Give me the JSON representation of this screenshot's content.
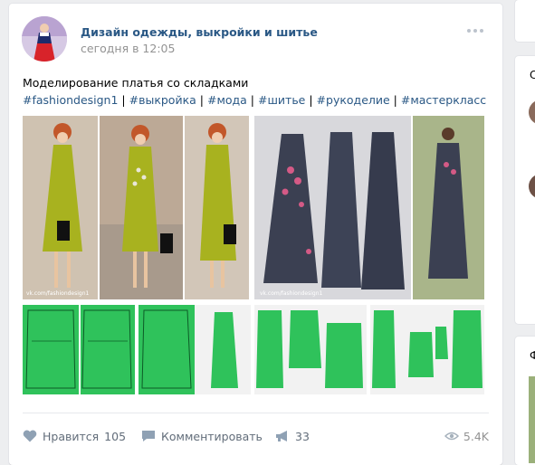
{
  "post": {
    "author": "Дизайн одежды, выкройки и шитье",
    "time": "сегодня в 12:05",
    "title": "Моделирование платья со складками",
    "hashtags": [
      "#fashiondesign1",
      "#выкройка",
      "#мода",
      "#шитье",
      "#рукоделие",
      "#мастеркласс"
    ],
    "hashtag_separator": " | ",
    "photo_captions": {
      "watermark_left": "vk.com/fashiondesign1",
      "watermark_right": "vk.com/fashiondesign1"
    }
  },
  "actions": {
    "like_label": "Нравится",
    "like_count": "105",
    "comment_label": "Комментировать",
    "share_count": "33",
    "views": "5.4K"
  },
  "sidebar": {
    "letter_top": "С",
    "letter_bottom": "Ф"
  },
  "colors": {
    "link": "#2a5885",
    "muted": "#939393",
    "pattern_green": "#2fc25b",
    "dress_green": "#a8b21f",
    "dress_navy": "#3b4052"
  },
  "icons": [
    "more-icon",
    "heart-icon",
    "comment-icon",
    "share-icon",
    "eye-icon"
  ]
}
